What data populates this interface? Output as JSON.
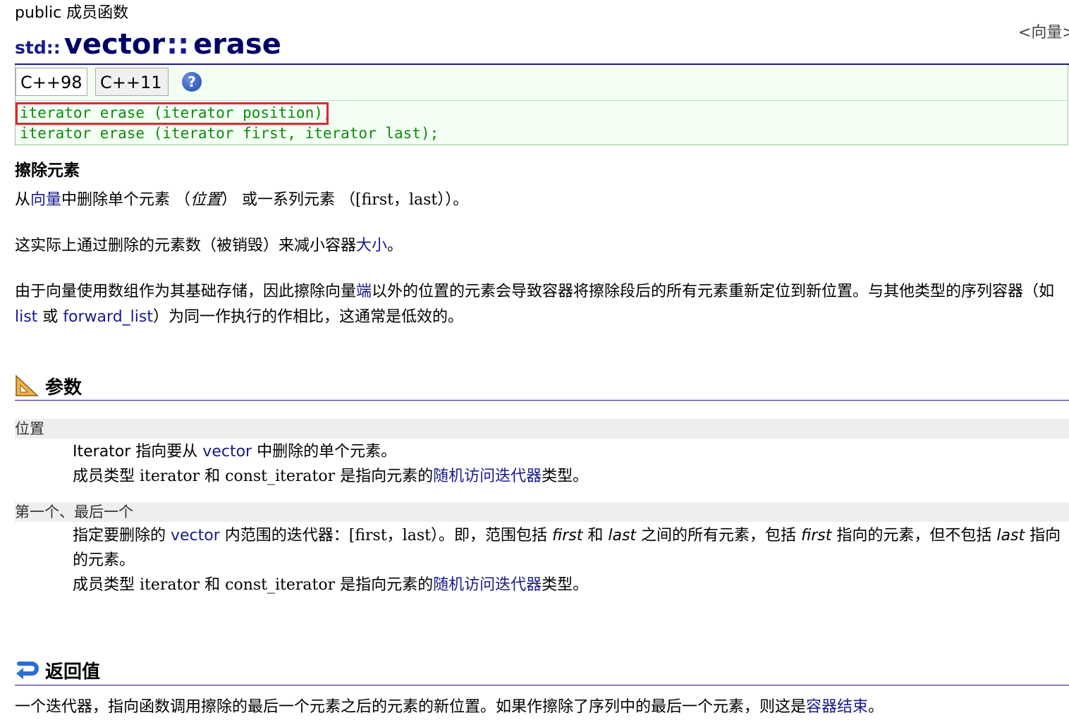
{
  "header": {
    "kind": "public 成员函数",
    "back_link": "<向量>",
    "namespace": "std::",
    "class_name": "vector",
    "scope_sep": "::",
    "function_name": "erase"
  },
  "tabs": [
    {
      "label": "C++98"
    },
    {
      "label": "C++11"
    }
  ],
  "help_icon": "?",
  "prototypes": [
    "iterator erase (iterator position);",
    "iterator erase (iterator first, iterator last);"
  ],
  "summary": {
    "heading": "擦除元素",
    "p1": {
      "a": "从",
      "link": "向量",
      "b": "中删除单个元素 （",
      "position": "位置",
      "c": "） 或一系列元素 （",
      "range": "[first，last）",
      "d": "）。"
    },
    "p2": {
      "a": "这实际上通过删除的元素数（被销毁）来减小容器",
      "link": "大小",
      "b": "。"
    },
    "p3": {
      "a": "由于向量使用数组作为其基础存储，因此擦除向量",
      "link_end": "端",
      "b": "以外的位置的元素会导致容器将擦除段后的所有元素重新定位到新位置。与其他类型的序列容器（如 ",
      "link_list": "list",
      "c": " 或 ",
      "link_forward_list": "forward_list",
      "d": "）为同一作执行的作相比，这通常是低效的。"
    }
  },
  "params": {
    "heading": "参数",
    "items": [
      {
        "name": "位置",
        "line1": {
          "a": "Iterator 指向要从 ",
          "link": "vector",
          "b": " 中删除的单个元素。"
        },
        "line2": {
          "a": "成员类型 ",
          "code1": "iterator",
          "b": " 和 ",
          "code2": "const_iterator",
          "c": " 是指向元素的",
          "link": "随机访问迭代器",
          "d": "类型。"
        }
      },
      {
        "name": "第一个、最后一个",
        "line1": {
          "a": "指定要删除的 ",
          "link": "vector",
          "b": " 内范围的迭代器：",
          "range": "[first，last）",
          "c": "。即，范围包括 ",
          "i1": "first",
          "d": " 和 ",
          "i2": "last",
          "e": " 之间的所有元素，包括 ",
          "i3": "first",
          "f": " 指向的元素，但不包括 ",
          "i4": "last",
          "g": " 指向的元素。"
        },
        "line2": {
          "a": "成员类型 ",
          "code1": "iterator",
          "b": " 和 ",
          "code2": "const_iterator",
          "c": " 是指向元素的",
          "link": "随机访问迭代器",
          "d": "类型。"
        }
      }
    ]
  },
  "return_value": {
    "heading": "返回值",
    "text": "一个迭代器，指向函数调用擦除的最后一个元素之后的元素的新位置。如果作擦除了序列中的最后一个元素，则这是",
    "link": "容器结束",
    "end": "。"
  },
  "icons": {
    "params_icon": "ruler-triangle-icon",
    "return_icon": "return-arrow-icon"
  },
  "colors": {
    "link": "#1a1a8c",
    "prototype_text": "#0e8a0e",
    "highlight_box": "#e0282e",
    "prototype_bg": "#f4fff4"
  }
}
